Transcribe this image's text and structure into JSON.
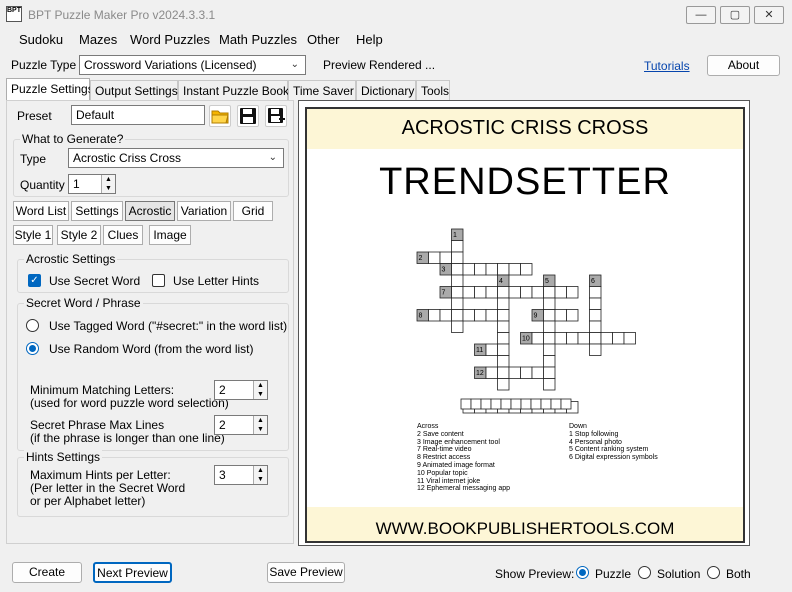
{
  "window": {
    "title": "BPT Puzzle Maker Pro v2024.3.3.1",
    "icon_text": "BPT"
  },
  "menu": [
    "Sudoku",
    "Mazes",
    "Word Puzzles",
    "Math Puzzles",
    "Other",
    "Help"
  ],
  "top": {
    "puzzle_type_label": "Puzzle Type",
    "puzzle_type_value": "Crossword Variations (Licensed)",
    "status": "Preview Rendered ...",
    "tutorials": "Tutorials",
    "about": "About"
  },
  "tabs": [
    "Puzzle Settings",
    "Output Settings",
    "Instant Puzzle Books",
    "Time Saver",
    "Dictionary",
    "Tools"
  ],
  "settings": {
    "preset_label": "Preset",
    "preset_value": "Default",
    "generate_title": "What to Generate?",
    "type_label": "Type",
    "type_value": "Acrostic Criss Cross",
    "quantity_label": "Quantity",
    "quantity_value": "1",
    "subtabs_row1": [
      "Word List",
      "Settings",
      "Acrostic",
      "Variation",
      "Grid"
    ],
    "subtabs_row2": [
      "Style 1",
      "Style 2",
      "Clues",
      "Image"
    ],
    "acrostic_title": "Acrostic Settings",
    "use_secret_word": "Use Secret Word",
    "use_letter_hints": "Use Letter Hints",
    "secret_title": "Secret Word / Phrase",
    "use_tagged": "Use Tagged Word (\"#secret:\" in the word list)",
    "use_random": "Use Random Word (from the word list)",
    "min_match_label1": "Minimum Matching Letters:",
    "min_match_label2": "(used for word puzzle word selection)",
    "min_match_value": "2",
    "max_lines_label1": "Secret Phrase Max Lines",
    "max_lines_label2": "(if the phrase is longer than one line)",
    "max_lines_value": "2",
    "hints_title": "Hints Settings",
    "max_hints_label1": "Maximum Hints per Letter:",
    "max_hints_label2": "(Per letter in the Secret Word",
    "max_hints_label3": "or per Alphabet letter)",
    "max_hints_value": "3"
  },
  "preview": {
    "heading": "ACROSTIC CRISS CROSS",
    "secret_word": "TRENDSETTER",
    "across_title": "Across",
    "across": [
      "2 Save content",
      "3 Image enhancement tool",
      "7 Real-time video",
      "8 Restrict access",
      "9 Animated image format",
      "10 Popular topic",
      "11 Viral internet joke",
      "12 Ephemeral messaging app"
    ],
    "down_title": "Down",
    "down": [
      "1 Stop following",
      "4 Personal photo",
      "5 Content ranking system",
      "6 Digital expression symbols"
    ],
    "clue_numbers": [
      "1",
      "2",
      "3",
      "4",
      "5",
      "6",
      "7",
      "8",
      "9",
      "10",
      "11",
      "12"
    ],
    "url": "WWW.BOOKPUBLISHERTOOLS.COM"
  },
  "bottom": {
    "create": "Create",
    "next_preview": "Next Preview",
    "save_preview": "Save Preview",
    "show_preview": "Show Preview:",
    "puzzle": "Puzzle",
    "solution": "Solution",
    "both": "Both"
  },
  "colors": {
    "accent": "#0067c0",
    "band": "#fdf6d6",
    "link": "#0645ad"
  }
}
